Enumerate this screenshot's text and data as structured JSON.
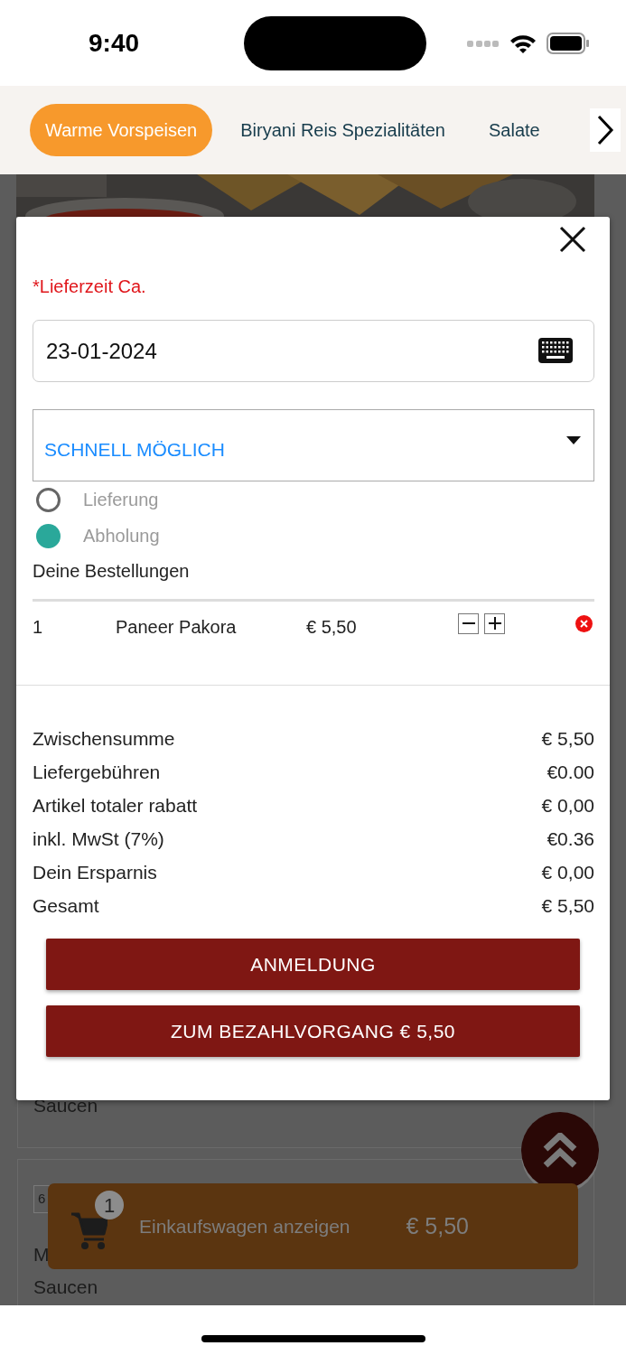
{
  "status_bar": {
    "time": "9:40"
  },
  "categories": [
    {
      "label": "Warme Vorspeisen",
      "selected": true
    },
    {
      "label": "Biryani Reis Spezialitäten",
      "selected": false
    },
    {
      "label": "Salate",
      "selected": false
    }
  ],
  "background_cards": [
    {
      "texts": [
        "Saucen"
      ]
    },
    {
      "quantity": "6",
      "texts": [
        "M",
        "Saucen"
      ]
    }
  ],
  "modal": {
    "title": "*Lieferzeit Ca.",
    "date_field": {
      "value": "23-01-2024"
    },
    "time_select": {
      "value": "SCHNELL MÖGLICH"
    },
    "order_types": [
      {
        "label": "Lieferung",
        "selected": false
      },
      {
        "label": "Abholung",
        "selected": true
      }
    ],
    "orders_heading": "Deine Bestellungen",
    "order_items": [
      {
        "quantity": "1",
        "name": "Paneer Pakora",
        "price": "€ 5,50"
      }
    ],
    "summary": [
      {
        "label": "Zwischensumme",
        "value": "€ 5,50"
      },
      {
        "label": "Liefergebühren",
        "value": "€0.00"
      },
      {
        "label": "Artikel totaler rabatt",
        "value": "€ 0,00"
      },
      {
        "label": "inkl. MwSt (7%)",
        "value": "€0.36"
      },
      {
        "label": "Dein Ersparnis",
        "value": "€ 0,00"
      },
      {
        "label": "Gesamt",
        "value": "€ 5,50"
      }
    ],
    "buttons": [
      "ANMELDUNG",
      "ZUM BEZAHLVORGANG € 5,50"
    ]
  },
  "cart_bar": {
    "count": "1",
    "label": "Einkaufswagen anzeigen",
    "total": "€ 5,50"
  }
}
